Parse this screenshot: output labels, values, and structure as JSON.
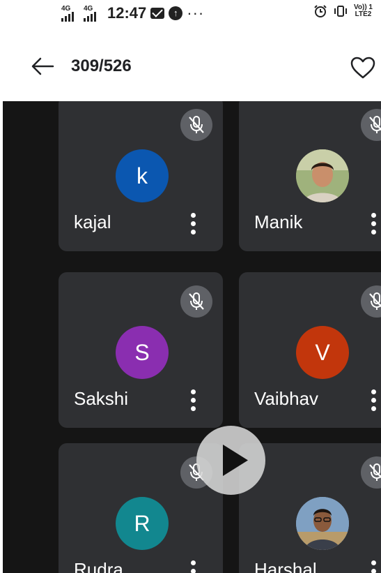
{
  "status_bar": {
    "network_1": "4G",
    "network_2": "4G",
    "time": "12:47",
    "more": "···",
    "volte_top": "Vo)) 1",
    "volte_bottom": "LTE2"
  },
  "header": {
    "counter": "309/526"
  },
  "participants": [
    {
      "name": "kajal",
      "initial": "k",
      "color": "#0b57b0",
      "type": "initial"
    },
    {
      "name": "Manik",
      "initial": "",
      "color": "#8a9a6e",
      "type": "photo"
    },
    {
      "name": "Sakshi",
      "initial": "S",
      "color": "#8a2eb0",
      "type": "initial"
    },
    {
      "name": "Vaibhav",
      "initial": "V",
      "color": "#c2360c",
      "type": "initial"
    },
    {
      "name": "Rudra",
      "initial": "R",
      "color": "#12878f",
      "type": "initial"
    },
    {
      "name": "Harshal",
      "initial": "",
      "color": "#6b8aa8",
      "type": "photo"
    }
  ],
  "colors": {
    "tile_bg": "#2f3033",
    "stage_bg": "#151515",
    "mic_bg": "#5f6166"
  },
  "icons": {
    "back": "arrow-left-icon",
    "favorite": "heart-outline-icon",
    "mic": "mic-off-icon",
    "more": "more-vert-icon",
    "play": "play-icon"
  }
}
